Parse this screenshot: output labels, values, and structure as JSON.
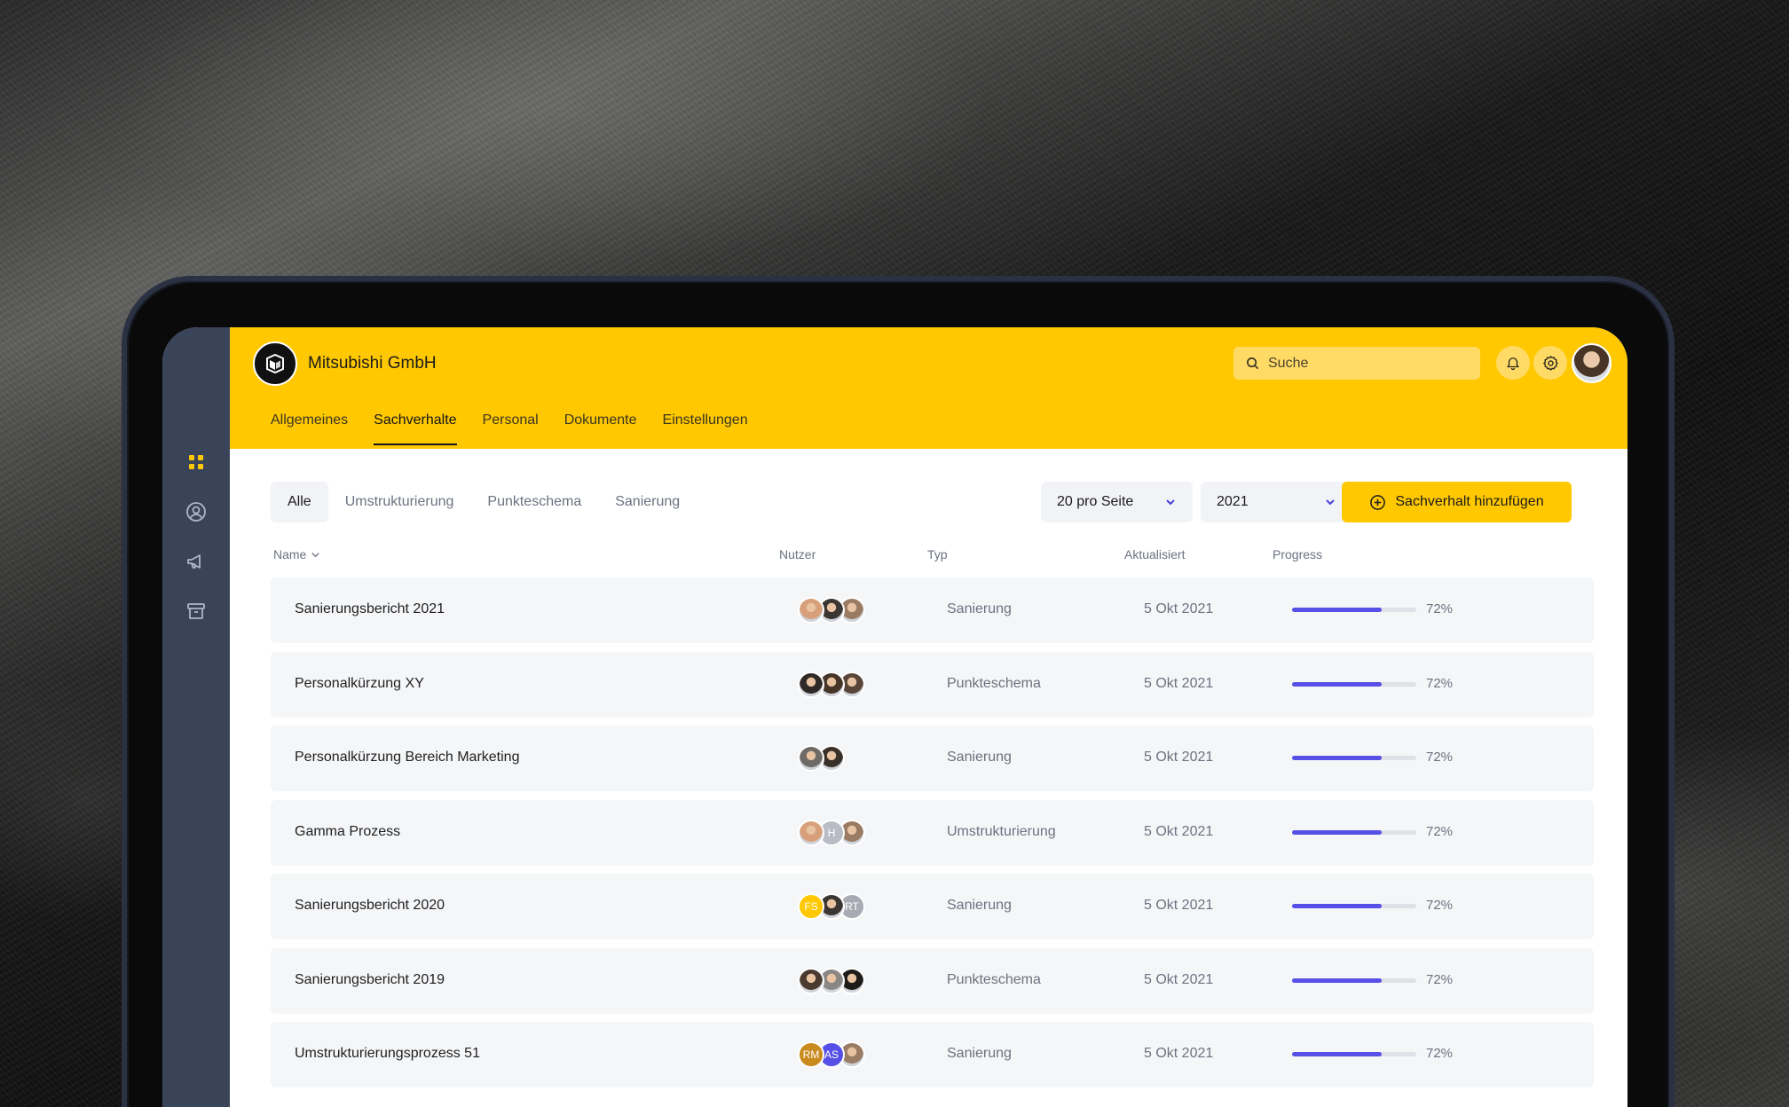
{
  "company": {
    "name": "Mitsubishi GmbH"
  },
  "search": {
    "placeholder": "Suche"
  },
  "nav": {
    "tabs": [
      {
        "label": "Allgemeines"
      },
      {
        "label": "Sachverhalte",
        "active": true
      },
      {
        "label": "Personal"
      },
      {
        "label": "Dokumente"
      },
      {
        "label": "Einstellungen"
      }
    ]
  },
  "filters": {
    "chips": [
      {
        "label": "Alle",
        "active": true
      },
      {
        "label": "Umstrukturierung"
      },
      {
        "label": "Punkteschema"
      },
      {
        "label": "Sanierung"
      }
    ],
    "per_page": "20 pro Seite",
    "year": "2021",
    "add_label": "Sachverhalt hinzufügen"
  },
  "columns": {
    "name": "Name",
    "users": "Nutzer",
    "type": "Typ",
    "updated": "Aktualisiert",
    "progress": "Progress"
  },
  "rows": [
    {
      "name": "Sanierungsbericht 2021",
      "type": "Sanierung",
      "updated": "5 Okt 2021",
      "progress": 0.72,
      "progress_label": "72%",
      "avatars": [
        {
          "kind": "photo",
          "color": "#d7a07a"
        },
        {
          "kind": "photo",
          "color": "#3b3631"
        },
        {
          "kind": "photo",
          "color": "#9a7b64"
        }
      ]
    },
    {
      "name": "Personalkürzung XY",
      "type": "Punkteschema",
      "updated": "5 Okt 2021",
      "progress": 0.72,
      "progress_label": "72%",
      "avatars": [
        {
          "kind": "photo",
          "color": "#2f2a27"
        },
        {
          "kind": "photo",
          "color": "#463529"
        },
        {
          "kind": "photo",
          "color": "#5a4638"
        }
      ]
    },
    {
      "name": "Personalkürzung Bereich Marketing",
      "type": "Sanierung",
      "updated": "5 Okt 2021",
      "progress": 0.72,
      "progress_label": "72%",
      "avatars": [
        {
          "kind": "photo",
          "color": "#6e6a66"
        },
        {
          "kind": "photo",
          "color": "#3a302a"
        }
      ]
    },
    {
      "name": "Gamma Prozess",
      "type": "Umstrukturierung",
      "updated": "5 Okt 2021",
      "progress": 0.72,
      "progress_label": "72%",
      "avatars": [
        {
          "kind": "photo",
          "color": "#d7a07a"
        },
        {
          "kind": "initials",
          "text": "H",
          "color": "#b9bcc4"
        },
        {
          "kind": "photo",
          "color": "#9a7b64"
        }
      ]
    },
    {
      "name": "Sanierungsbericht 2020",
      "type": "Sanierung",
      "updated": "5 Okt 2021",
      "progress": 0.72,
      "progress_label": "72%",
      "avatars": [
        {
          "kind": "initials",
          "text": "FS",
          "color": "#ffc800"
        },
        {
          "kind": "photo",
          "color": "#3b3631"
        },
        {
          "kind": "initials",
          "text": "RT",
          "color": "#a8abb3"
        }
      ]
    },
    {
      "name": "Sanierungsbericht 2019",
      "type": "Punkteschema",
      "updated": "5 Okt 2021",
      "progress": 0.72,
      "progress_label": "72%",
      "avatars": [
        {
          "kind": "photo",
          "color": "#4a3a30"
        },
        {
          "kind": "photo",
          "color": "#8a8784"
        },
        {
          "kind": "photo",
          "color": "#1f1b19"
        }
      ]
    },
    {
      "name": "Umstrukturierungsprozess 51",
      "type": "Sanierung",
      "updated": "5 Okt 2021",
      "progress": 0.72,
      "progress_label": "72%",
      "avatars": [
        {
          "kind": "initials",
          "text": "RM",
          "color": "#c98a1e"
        },
        {
          "kind": "initials",
          "text": "AS",
          "color": "#5650e6"
        },
        {
          "kind": "photo",
          "color": "#9a7b64"
        }
      ]
    }
  ],
  "colors": {
    "brand": "#ffc800",
    "rail": "#394459",
    "progress": "#5650e6"
  }
}
